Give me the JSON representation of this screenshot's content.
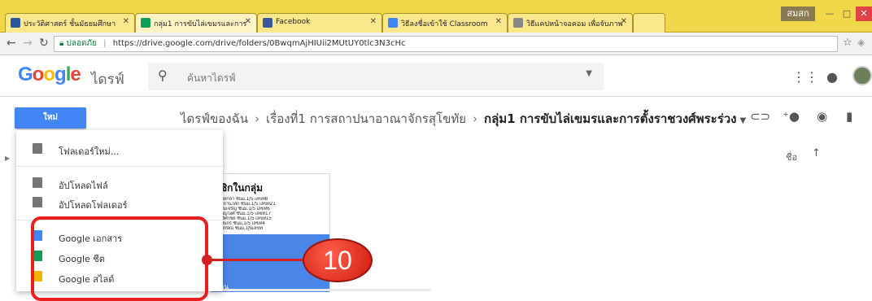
{
  "browser": {
    "tabs": [
      {
        "title": "ประวัติศาสตร์ ชั้นมัธยมศึกษา",
        "favicon_color": "#2b579a"
      },
      {
        "title": "กลุ่ม1 การขับไล่เขมรและการ",
        "favicon_color": "#0f9d58"
      },
      {
        "title": "Facebook",
        "favicon_color": "#3b5998"
      },
      {
        "title": "วิธีลงชื่อเข้าใช้ Classroom",
        "favicon_color": "#4285f4"
      },
      {
        "title": "วิธีแคปหน้าจอคอม เพื่อจับภาพ",
        "favicon_color": "#888888"
      }
    ],
    "window_user": "สมสก",
    "secure_label": "ปลอดภัย",
    "url": "https://drive.google.com/drive/folders/0BwqmAjHIUii2MUtUY0tlc3N3cHc"
  },
  "drive": {
    "logo_letters": [
      "G",
      "o",
      "o",
      "g",
      "l",
      "e"
    ],
    "logo_colors": [
      "#4285f4",
      "#ea4335",
      "#fbbc05",
      "#4285f4",
      "#34a853",
      "#ea4335"
    ],
    "product_name": "ไดรฟ์",
    "search_placeholder": "ค้นหาไดรฟ์"
  },
  "toolbar": {
    "new_label": "ใหม่",
    "breadcrumb": [
      "ไดรฟ์ของฉัน",
      "เรื่องที่1 การสถาปนาอาณาจักรสุโขทัย"
    ],
    "current_folder": "กลุ่ม1 การขับไล่เขมรและการตั้งราชวงศ์พระร่วง",
    "sort_label": "ชื่อ"
  },
  "menu": {
    "items": [
      {
        "label": "โฟลเดอร์ใหม่...",
        "icon": "new-folder-icon",
        "color": "#757575"
      },
      {
        "label": "อัปโหลดไฟล์",
        "icon": "upload-file-icon",
        "color": "#757575"
      },
      {
        "label": "อัปโหลดโฟลเดอร์",
        "icon": "upload-folder-icon",
        "color": "#757575"
      },
      {
        "label": "Google เอกสาร",
        "icon": "google-docs-icon",
        "color": "#4285f4"
      },
      {
        "label": "Google ชีต",
        "icon": "google-sheets-icon",
        "color": "#0f9d58"
      },
      {
        "label": "Google สไลด์",
        "icon": "google-slides-icon",
        "color": "#f4b400"
      }
    ]
  },
  "file_card": {
    "title": "ชิกในกลุ่ม",
    "lines": [
      "มหกล้า   ชั้นม.1/5 เลขที่8",
      "สถานโสก ชั้นม.1/5 เลขที่21",
      "สมเจริญ  ชั้นม.1/5 เลขที่6",
      "บุญวงศ์    ชั้นม.1/5 เลขที่17",
      "เลิศไชย์  ชั้นม.1/5 เลขที่15",
      "ทินกร     ชั้นม.1/5 เลขที่4",
      "ทักษิณ์   ชั้นม.1/ุนเลขที่"
    ],
    "footer_text": "าน"
  },
  "annotation": {
    "number": "10",
    "color": "#d32020"
  }
}
